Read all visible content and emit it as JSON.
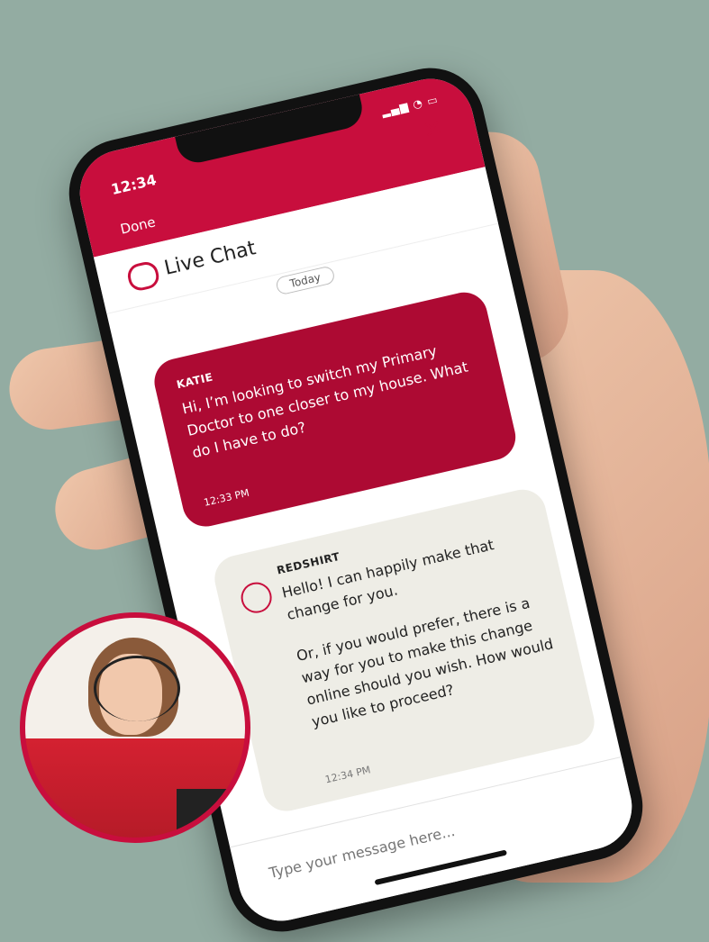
{
  "status_bar": {
    "time": "12:34",
    "signal_label": "▂▄▆ ◔ ▭"
  },
  "nav": {
    "done_label": "Done",
    "close_label": "✕"
  },
  "header": {
    "title": "Live Chat"
  },
  "date_divider": "Today",
  "messages": [
    {
      "sender": "KATIE",
      "text": "Hi, I’m looking to switch my Primary Doctor to one closer to my house. What do I have to do?",
      "time": "12:33 PM"
    },
    {
      "sender": "REDSHIRT",
      "text_1": "Hello! I can happily make that change for you.",
      "text_2": "Or, if you would prefer, there is a way for you to make this change online should you wish. How would you like to proceed?",
      "time": "12:34 PM"
    }
  ],
  "composer": {
    "placeholder": "Type your message here..."
  },
  "colors": {
    "accent": "#c80e3d",
    "agent_bubble": "#eeede6",
    "user_bubble": "#ad0a33",
    "background": "#93aca2"
  }
}
